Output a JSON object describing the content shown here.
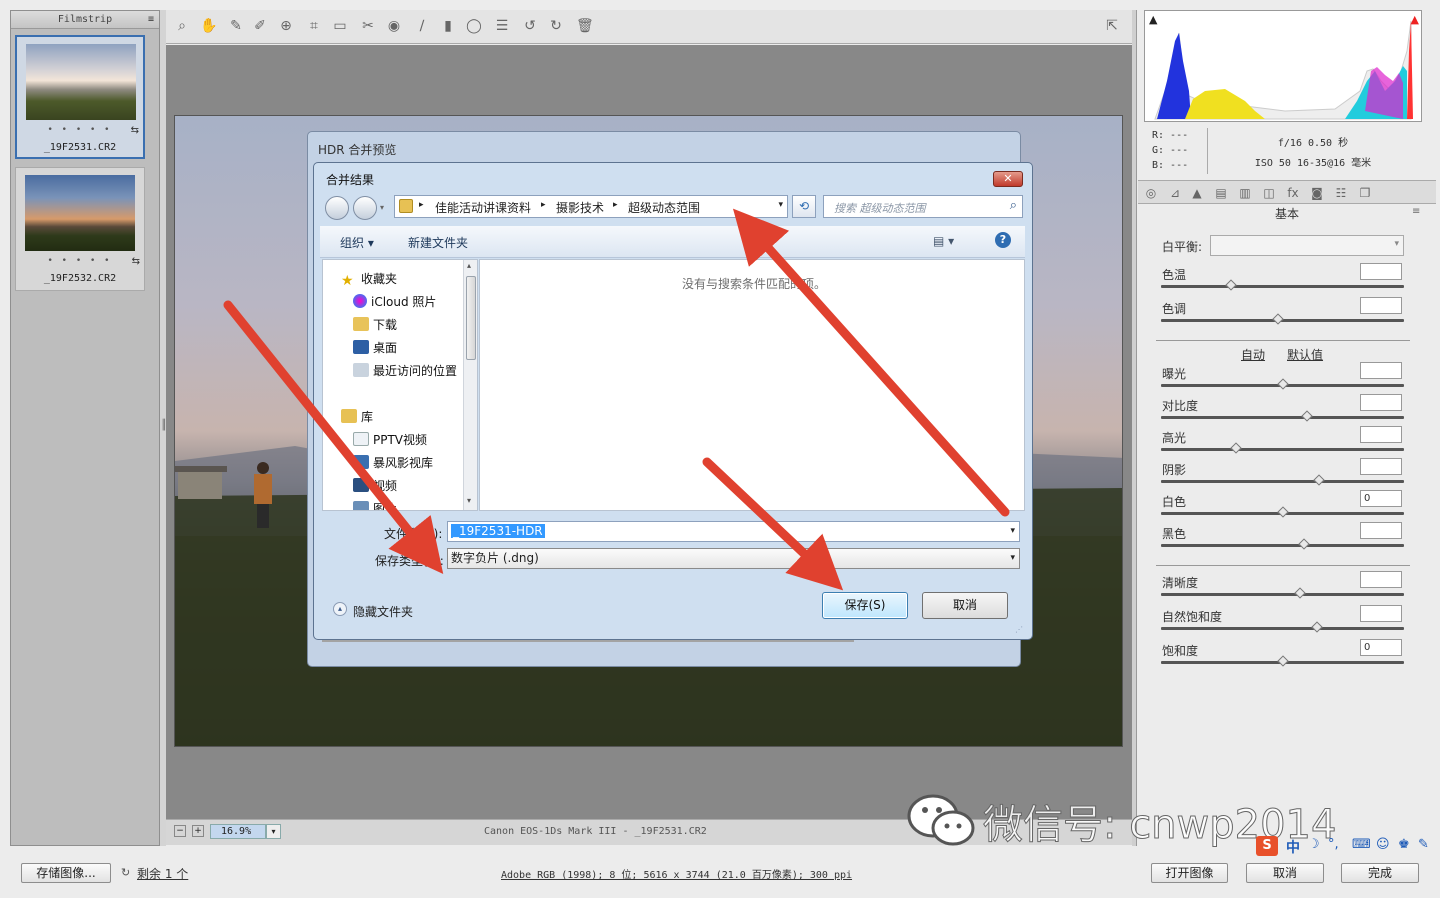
{
  "filmstrip": {
    "title": "Filmstrip",
    "items": [
      {
        "name": "_19F2531.CR2",
        "stars": "• • • • •"
      },
      {
        "name": "_19F2532.CR2",
        "stars": "• • • • •"
      }
    ]
  },
  "statusbar": {
    "zoom": "16.9%",
    "camera": "Canon EOS-1Ds Mark III  -  _19F2531.CR2"
  },
  "camera_info": {
    "r": "R:  ---",
    "g": "G:  ---",
    "b": "B:  ---",
    "aperture_shutter": "f/16   0.50 秒",
    "iso_lens": "ISO 50   16-35@16 毫米"
  },
  "panel": {
    "title": "基本",
    "white_balance_label": "白平衡:",
    "auto_link": "自动",
    "default_link": "默认值",
    "sliders_wb": [
      {
        "label": "色温",
        "value": "",
        "pos": 0.29
      },
      {
        "label": "色调",
        "value": "",
        "pos": 0.48
      }
    ],
    "sliders_tone": [
      {
        "label": "曝光",
        "value": "",
        "pos": 0.5
      },
      {
        "label": "对比度",
        "value": "",
        "pos": 0.6
      },
      {
        "label": "高光",
        "value": "",
        "pos": 0.31
      },
      {
        "label": "阴影",
        "value": "",
        "pos": 0.65
      },
      {
        "label": "白色",
        "value": "0",
        "pos": 0.5
      },
      {
        "label": "黑色",
        "value": "",
        "pos": 0.59
      }
    ],
    "sliders_presence": [
      {
        "label": "清晰度",
        "value": "",
        "pos": 0.57
      },
      {
        "label": "自然饱和度",
        "value": "",
        "pos": 0.64
      },
      {
        "label": "饱和度",
        "value": "0",
        "pos": 0.5
      }
    ]
  },
  "bottom": {
    "save_image": "存储图像...",
    "remaining": "剩余 1 个",
    "workflow": "Adobe RGB (1998); 8 位; 5616 x 3744 (21.0 百万像素); 300 ppi",
    "open_image": "打开图像",
    "cancel": "取消",
    "done": "完成"
  },
  "hdr_dialog": {
    "title": "HDR 合并预览"
  },
  "save_dialog": {
    "title": "合并结果",
    "breadcrumb": [
      "佳能活动讲课资料",
      "摄影技术",
      "超级动态范围"
    ],
    "search_placeholder": "搜索 超级动态范围",
    "organize": "组织",
    "new_folder": "新建文件夹",
    "empty_message": "没有与搜索条件匹配的项。",
    "nav": {
      "favorites": "收藏夹",
      "favorites_items": [
        "iCloud 照片",
        "下载",
        "桌面",
        "最近访问的位置"
      ],
      "libraries": "库",
      "library_items": [
        "PPTV视频",
        "暴风影视库",
        "视频",
        "图片"
      ]
    },
    "filename_label": "文件名(N):",
    "filename_value": "_19F2531-HDR",
    "filetype_label": "保存类型(T):",
    "filetype_value": "数字负片 (.dng)",
    "hide_folders": "隐藏文件夹",
    "save_button": "保存(S)",
    "cancel_button": "取消"
  },
  "watermark": {
    "text": "微信号: cnwp2014"
  },
  "ime": {
    "lang": "中"
  }
}
